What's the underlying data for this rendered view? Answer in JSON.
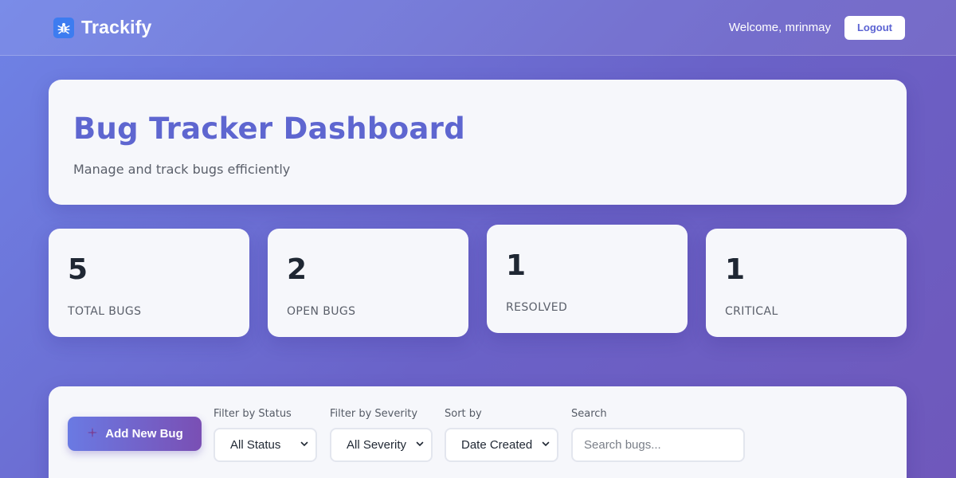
{
  "header": {
    "brand_name": "Trackify",
    "brand_icon": "bug-icon",
    "welcome_text": "Welcome, mrinmay",
    "logout_label": "Logout"
  },
  "hero": {
    "title": "Bug Tracker Dashboard",
    "subtitle": "Manage and track bugs efficiently"
  },
  "stats": [
    {
      "value": "5",
      "label": "TOTAL BUGS"
    },
    {
      "value": "2",
      "label": "OPEN BUGS"
    },
    {
      "value": "1",
      "label": "RESOLVED"
    },
    {
      "value": "1",
      "label": "CRITICAL"
    }
  ],
  "controls": {
    "add_bug_label": "Add New Bug",
    "add_bug_icon": "sparkle-plus-icon",
    "status_filter": {
      "label": "Filter by Status",
      "selected": "All Status"
    },
    "severity_filter": {
      "label": "Filter by Severity",
      "selected": "All Severity"
    },
    "sort": {
      "label": "Sort by",
      "selected": "Date Created"
    },
    "search": {
      "label": "Search",
      "placeholder": "Search bugs..."
    }
  },
  "colors": {
    "accent": "#5e66d0",
    "brand_icon_bg": "#3d7cf0",
    "card_bg": "#f6f7fb"
  }
}
